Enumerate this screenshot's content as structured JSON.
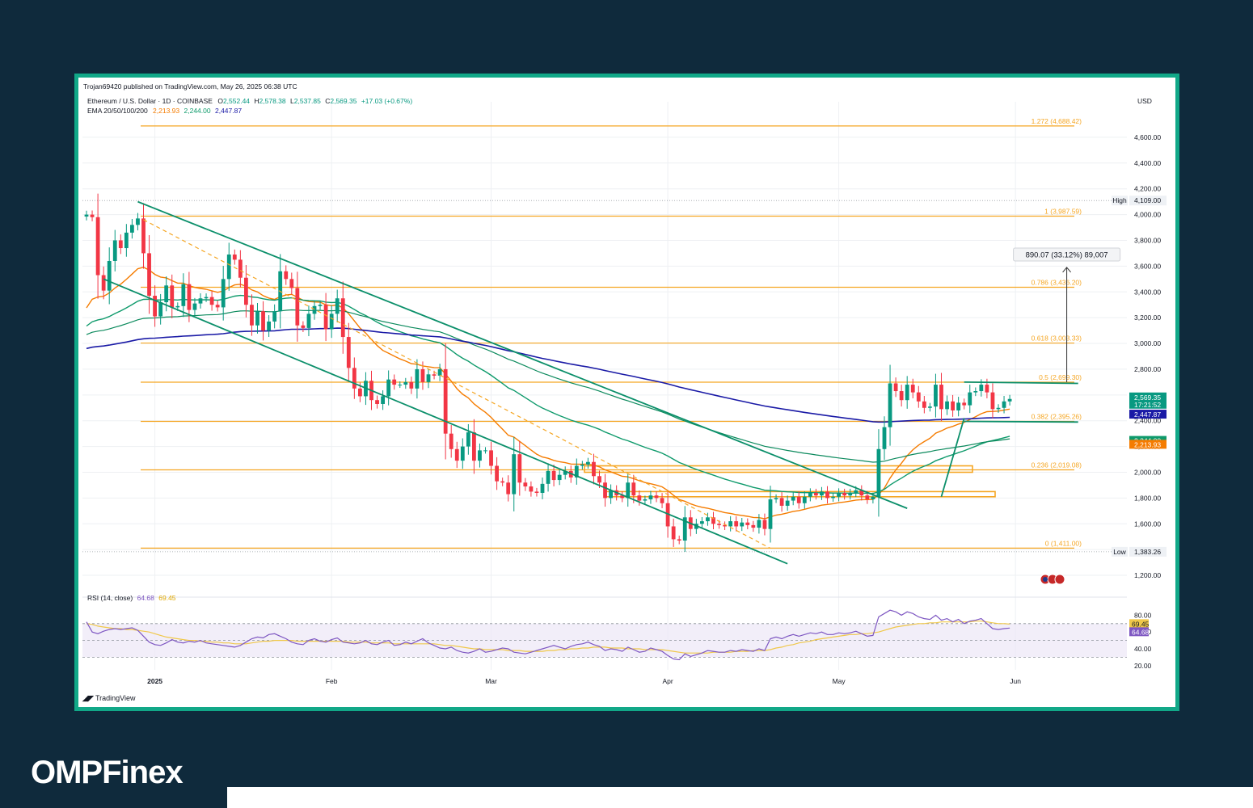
{
  "publisher": "Trojan69420 published on TradingView.com, May 26, 2025 06:38 UTC",
  "symbol": {
    "name": "Ethereum / U.S. Dollar · 1D · COINBASE",
    "open_label": "O",
    "open": "2,552.44",
    "high_label": "H",
    "high": "2,578.38",
    "low_label": "L",
    "low": "2,537.85",
    "close_label": "C",
    "close": "2,569.35",
    "change": "+17.03 (+0.67%)"
  },
  "ema": {
    "label": "EMA 20/50/100/200",
    "v20": "2,213.93",
    "v50": "2,244.00",
    "v200": "2,447.87"
  },
  "currency": "USD",
  "rsi_legend": {
    "label": "RSI (14, close)",
    "rsi": "64.68",
    "ma": "69.45"
  },
  "footer_logo": "TradingView",
  "brand": "OMPFinex",
  "colors": {
    "up": "#089981",
    "down": "#f23645",
    "fib": "#f5a623",
    "channel": "#0b8f6a",
    "ema20": "#f57c00",
    "ema50": "#0e9a6b",
    "ema200": "#1a1aa6",
    "rsi": "#7e57c2",
    "rsi_ma": "#f0c84a"
  },
  "chart_data": {
    "type": "candlestick",
    "ylim": [
      1100,
      4750
    ],
    "y_ticks": [
      1200,
      1400,
      1600,
      1800,
      2000,
      2200,
      2400,
      2600,
      2800,
      3000,
      3200,
      3400,
      3600,
      3800,
      4000,
      4200,
      4400,
      4600
    ],
    "y_tick_labels": [
      "1,200.00",
      "1,400.00",
      "1,600.00",
      "1,800.00",
      "2,000.00",
      "2,200.00",
      "2,400.00",
      "2,600.00",
      "2,800.00",
      "3,000.00",
      "3,200.00",
      "3,400.00",
      "3,600.00",
      "3,800.00",
      "4,000.00",
      "4,200.00",
      "4,400.00",
      "4,600.00"
    ],
    "x_ticks": [
      {
        "label": "2025",
        "day": 12
      },
      {
        "label": "Feb",
        "day": 43
      },
      {
        "label": "Mar",
        "day": 71
      },
      {
        "label": "Apr",
        "day": 102
      },
      {
        "label": "May",
        "day": 132
      },
      {
        "label": "Jun",
        "day": 163
      }
    ],
    "closes": [
      4000,
      3980,
      3530,
      3410,
      3640,
      3800,
      3740,
      3860,
      3920,
      3970,
      3700,
      3370,
      3210,
      3320,
      3450,
      3280,
      3290,
      3460,
      3260,
      3310,
      3350,
      3360,
      3300,
      3280,
      3500,
      3690,
      3650,
      3510,
      3300,
      3140,
      3250,
      3100,
      3170,
      3250,
      3560,
      3500,
      3430,
      3140,
      3120,
      3230,
      3290,
      3300,
      3110,
      3230,
      3350,
      3050,
      2810,
      2650,
      2590,
      2710,
      2560,
      2530,
      2590,
      2720,
      2680,
      2680,
      2700,
      2650,
      2800,
      2700,
      2760,
      2750,
      2800,
      2300,
      2180,
      2090,
      2200,
      2310,
      2090,
      2170,
      2170,
      2050,
      1930,
      1920,
      1830,
      2140,
      1920,
      1890,
      1850,
      1840,
      1910,
      2010,
      1940,
      1980,
      2010,
      1960,
      2050,
      2060,
      2080,
      1970,
      1920,
      1800,
      1860,
      1820,
      1800,
      1920,
      1820,
      1780,
      1790,
      1820,
      1800,
      1760,
      1580,
      1480,
      1470,
      1650,
      1560,
      1600,
      1620,
      1650,
      1600,
      1590,
      1580,
      1620,
      1580,
      1610,
      1590,
      1570,
      1630,
      1560,
      1790,
      1800,
      1740,
      1780,
      1810,
      1760,
      1810,
      1840,
      1820,
      1850,
      1800,
      1810,
      1840,
      1820,
      1840,
      1860,
      1820,
      1790,
      1810,
      2180,
      2350,
      2690,
      2630,
      2560,
      2680,
      2620,
      2550,
      2500,
      2510,
      2680,
      2490,
      2550,
      2480,
      2540,
      2520,
      2620,
      2630,
      2680,
      2620,
      2490,
      2500,
      2550,
      2569
    ],
    "high_ref": {
      "label": "High",
      "value": "4,109.00",
      "v": 4109
    },
    "low_ref": {
      "label": "Low",
      "value": "1,383.26",
      "v": 1383
    },
    "fib_levels": [
      {
        "label": "1.272 (4,688.42)",
        "v": 4688
      },
      {
        "label": "1 (3,987.59)",
        "v": 3988
      },
      {
        "label": "0.786 (3,436.20)",
        "v": 3436
      },
      {
        "label": "0.618 (3,003.33)",
        "v": 3003
      },
      {
        "label": "0.5 (2,699.30)",
        "v": 2699
      },
      {
        "label": "0.382 (2,395.26)",
        "v": 2395
      },
      {
        "label": "0.236 (2,019.08)",
        "v": 2019
      },
      {
        "label": "0 (1,411.00)",
        "v": 1411
      }
    ],
    "measure_label": "890.07 (33.12%) 89,007",
    "price_tags": [
      {
        "label": "2,569.35",
        "sub": "17:21:52",
        "v": 2569,
        "color": "#089981"
      },
      {
        "label": "2,447.87",
        "v": 2448,
        "color": "#1a1aa6"
      },
      {
        "label": "2,244.00",
        "v": 2244,
        "color": "#0e9a6b"
      },
      {
        "label": "2,213.93",
        "v": 2214,
        "color": "#f57c00"
      }
    ],
    "rsi": {
      "ylim": [
        15,
        90
      ],
      "ticks": [
        20,
        40,
        60,
        80
      ],
      "tick_labels": [
        "20.00",
        "40.00",
        "60.00",
        "80.00"
      ],
      "bands": [
        30,
        70
      ],
      "values": [
        72,
        60,
        58,
        61,
        63,
        64,
        63,
        64,
        65,
        62,
        55,
        48,
        45,
        44,
        47,
        51,
        48,
        47,
        49,
        48,
        50,
        47,
        46,
        45,
        44,
        43,
        42,
        44,
        48,
        52,
        54,
        53,
        57,
        58,
        55,
        52,
        48,
        46,
        45,
        50,
        52,
        49,
        48,
        51,
        53,
        48,
        47,
        46,
        47,
        50,
        46,
        45,
        48,
        50,
        44,
        45,
        48,
        46,
        49,
        52,
        47,
        44,
        41,
        40,
        42,
        38,
        36,
        35,
        37,
        40,
        36,
        37,
        39,
        41,
        40,
        36,
        35,
        34,
        36,
        38,
        40,
        42,
        44,
        42,
        40,
        43,
        45,
        46,
        48,
        45,
        43,
        38,
        40,
        39,
        37,
        42,
        39,
        36,
        37,
        41,
        39,
        37,
        32,
        28,
        27,
        34,
        31,
        33,
        35,
        38,
        37,
        36,
        36,
        38,
        37,
        39,
        38,
        37,
        40,
        38,
        52,
        54,
        52,
        55,
        57,
        55,
        57,
        59,
        58,
        60,
        57,
        57,
        59,
        58,
        59,
        61,
        58,
        55,
        56,
        78,
        82,
        86,
        84,
        80,
        84,
        82,
        78,
        76,
        75,
        80,
        74,
        76,
        72,
        75,
        70,
        73,
        74,
        76,
        70,
        64,
        63,
        64,
        64.68
      ],
      "ma": [
        70,
        69,
        67,
        66,
        65,
        64,
        64,
        63,
        63,
        62,
        61,
        60,
        58,
        56,
        54,
        53,
        52,
        51,
        50,
        50,
        49,
        49,
        48,
        48,
        47,
        47,
        46,
        46,
        46,
        47,
        48,
        49,
        49,
        50,
        50,
        50,
        50,
        49,
        49,
        49,
        49,
        49,
        49,
        49,
        49,
        49,
        48,
        48,
        48,
        48,
        47,
        47,
        47,
        47,
        46,
        46,
        46,
        46,
        46,
        46,
        46,
        46,
        45,
        44,
        44,
        43,
        42,
        41,
        40,
        40,
        39,
        39,
        39,
        39,
        38,
        38,
        38,
        37,
        37,
        37,
        37,
        38,
        38,
        39,
        39,
        40,
        40,
        41,
        41,
        42,
        42,
        42,
        41,
        41,
        41,
        40,
        40,
        40,
        39,
        39,
        39,
        39,
        38,
        37,
        36,
        35,
        35,
        35,
        35,
        35,
        36,
        36,
        36,
        36,
        37,
        37,
        37,
        38,
        38,
        38,
        39,
        41,
        42,
        44,
        45,
        47,
        48,
        49,
        51,
        52,
        53,
        54,
        55,
        56,
        57,
        57,
        58,
        58,
        59,
        60,
        62,
        64,
        66,
        67,
        68,
        69,
        70,
        70,
        71,
        71,
        72,
        72,
        72,
        72,
        72,
        72,
        73,
        73,
        72,
        71,
        70,
        70,
        69.45
      ]
    }
  }
}
